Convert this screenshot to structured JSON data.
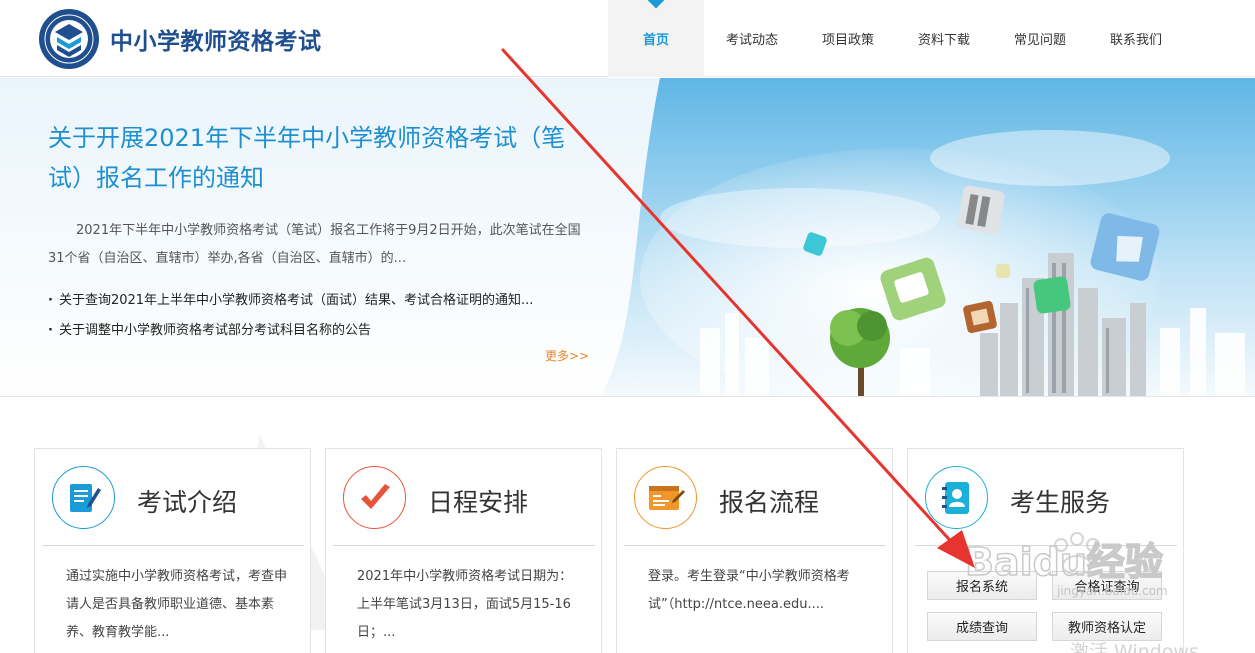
{
  "header": {
    "site_title": "中小学教师资格考试",
    "logo_icon": "education-badge-icon"
  },
  "nav": {
    "active_color": "#1a9ad6",
    "items": [
      {
        "label": "首页",
        "active": true
      },
      {
        "label": "考试动态",
        "active": false
      },
      {
        "label": "项目政策",
        "active": false
      },
      {
        "label": "资料下载",
        "active": false
      },
      {
        "label": "常见问题",
        "active": false
      },
      {
        "label": "联系我们",
        "active": false
      }
    ]
  },
  "banner": {
    "headline": "关于开展2021年下半年中小学教师资格考试（笔试）报名工作的通知",
    "summary": "2021年下半年中小学教师资格考试（笔试）报名工作将于9月2日开始，此次笔试在全国31个省（自治区、直辖市）举办,各省（自治区、直辖市）的...",
    "news": [
      "关于查询2021年上半年中小学教师资格考试（面试）结果、考试合格证明的通知...",
      "关于调整中小学教师资格考试部分考试科目名称的公告"
    ],
    "more_label": "更多>>"
  },
  "cards": [
    {
      "title": "考试介绍",
      "icon": "document-pen-icon",
      "color": "#1a9ad6",
      "text": "通过实施中小学教师资格考试，考查申请人是否具备教师职业道德、基本素养、教育教学能..."
    },
    {
      "title": "日程安排",
      "icon": "checkmark-icon",
      "color": "#e8543a",
      "text": "2021年中小学教师资格考试日期为：上半年笔试3月13日，面试5月15-16日；..."
    },
    {
      "title": "报名流程",
      "icon": "form-edit-icon",
      "color": "#f0962a",
      "text": "登录。考生登录“中小学教师资格考试”（http://ntce.neea.edu...."
    },
    {
      "title": "考生服务",
      "icon": "contact-book-icon",
      "color": "#1ab0d8",
      "buttons": [
        "报名系统",
        "合格证查询",
        "成绩查询",
        "教师资格认定"
      ]
    }
  ],
  "watermark": {
    "brand": "Baidu经验",
    "url": "jingyan.baidu.com"
  },
  "os_overlay": {
    "activate_text": "激活 Windows"
  },
  "annotation": {
    "arrow_color": "#e8342e"
  }
}
